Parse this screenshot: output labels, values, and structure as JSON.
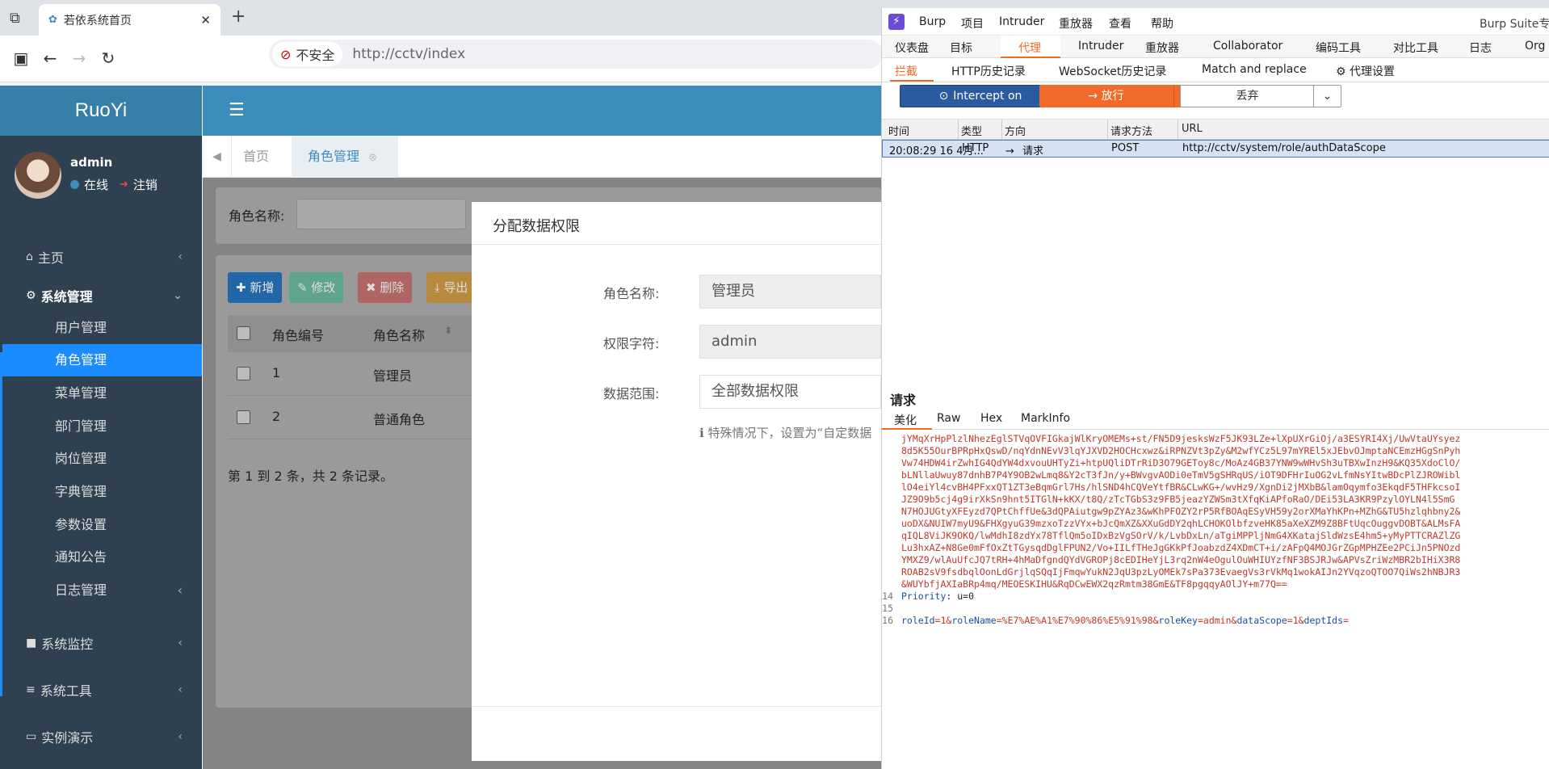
{
  "browser": {
    "tab_title": "若依系统首页",
    "tab_close": "✕",
    "new_tab": "+",
    "insecure_label": "不安全",
    "url": "http://cctv/index"
  },
  "app": {
    "logo": "RuoYi",
    "user": {
      "name": "admin",
      "status": "在线",
      "logout": "注销"
    },
    "menu": [
      {
        "label": "主页"
      },
      {
        "label": "系统管理"
      },
      {
        "label": "系统监控"
      },
      {
        "label": "系统工具"
      },
      {
        "label": "实例演示"
      }
    ],
    "submenu": [
      "用户管理",
      "角色管理",
      "菜单管理",
      "部门管理",
      "岗位管理",
      "字典管理",
      "参数设置",
      "通知公告",
      "日志管理"
    ],
    "tabs": {
      "home": "首页",
      "role": "角色管理"
    },
    "search": {
      "label": "角色名称:"
    },
    "toolbar": {
      "add": "新增",
      "edit": "修改",
      "delete": "删除",
      "export": "导出"
    },
    "table": {
      "headers": [
        "角色编号",
        "角色名称"
      ],
      "rows": [
        {
          "id": "1",
          "name": "管理员"
        },
        {
          "id": "2",
          "name": "普通角色"
        }
      ],
      "pager": "第 1 到 2 条，共 2 条记录。"
    }
  },
  "modal": {
    "title": "分配数据权限",
    "fields": [
      {
        "label": "角色名称:",
        "value": "管理员"
      },
      {
        "label": "权限字符:",
        "value": "admin"
      },
      {
        "label": "数据范围:",
        "value": "全部数据权限"
      }
    ],
    "hint": "特殊情况下，设置为“自定数据"
  },
  "burp": {
    "menu": [
      "Burp",
      "项目",
      "Intruder",
      "重放器",
      "查看",
      "帮助"
    ],
    "title": "Burp Suite专",
    "tabs": [
      "仪表盘",
      "目标",
      "代理",
      "Intruder",
      "重放器",
      "Collaborator",
      "编码工具",
      "对比工具",
      "日志",
      "Org"
    ],
    "subtabs": [
      "拦截",
      "HTTP历史记录",
      "WebSocket历史记录",
      "Match and replace",
      "代理设置"
    ],
    "buttons": {
      "intercept": "Intercept on",
      "forward": "放行",
      "drop": "丢弃"
    },
    "history_headers": [
      "时间",
      "类型",
      "方向",
      "请求方法",
      "URL"
    ],
    "history_row": {
      "time": "20:08:29 16 4月...",
      "type": "HTTP",
      "direction": "请求",
      "method": "POST",
      "url": "http://cctv/system/role/authDataScope"
    },
    "request_title": "请求",
    "request_tabs": [
      "美化",
      "Raw",
      "Hex",
      "MarkInfo"
    ],
    "code_lines": [
      "jYMqXrHpPlzlNhezEglSTVqOVFIGkajWlKryOMEMs+st/FN5D9jesksWzF5JK93LZe+lXpUXrGiOj/a3ESYRI4Xj/UwVtaUYsyez",
      "8d5K55OurBPRpHxQswD/nqYdnNEvV3lqYJXVD2HOCHcxwz&iRPNZVt3pZy&M2wfYCz5L97mYREl5xJEbvOJmptaNCEmzHGgSnPyh",
      "Vw74HDW4irZwhIG4QdYW4dxvouUHTyZi+htpUQliDTrRiD3O79GEToy8c/MoAz4GB37YNW9wWHvSh3uTBXwInzH9&KQ35XdoClO/",
      "bLNllaUwuy87dnhB7P4Y9OB2wLmq8&Y2cT3fJn/y+BWvgvAODi0eTmV5gSHRqUS/iOT9DFHrIuOG2vLfmNsYItwBDcPlZJROWibl",
      "lO4eiYl4cvBH4PFxxQT1ZT3eBqmGrl7Hs/hlSND4hCQVeYtfBR&CLwKG+/wvHz9/XgnDi2jMXbB&lamOqymfo3EkqdF5THFkcsoI",
      "JZ9O9b5cj4g9irXkSn9hnt5ITGlN+kKX/t8Q/zTcTGbS3z9FB5jeazYZWSm3tXfqKiAPfoRaO/DEi53LA3KR9PzylOYLN4l5SmG",
      "N7HOJUGtyXFEyzd7QPtChffUe&3dQPAiutgw9pZYAz3&wKhPFOZY2rP5RfBOAqESyVH59y2orXMaYhKPn+MZhG&TU5hzlqhbny2&",
      "uoDX&NUIW7myU9&FHXgyuG39mzxoTzzVYx+bJcQmXZ&XXuGdDY2qhLCHOKOlbfzveHK85aXeXZM9Z8BFtUqcOuggvDOBT&ALMsFA",
      "qIQL8ViJK9OKQ/lwMdhI8zdYx78TflQm5oIDxBzVgSOrV/k/LvbDxLn/aTgiMPPljNmG4XKatajSldWzsE4hm5+yMyPTTCRAZlZG",
      "Lu3hxAZ+N8Ge0mFfOxZtTGysqdDglFPUN2/Vo+IILfTHeJgGKkPfJoabzdZ4XDmCT+i/zAFpQ4MOJGrZGpMPHZEe2PCiJn5PNOzd",
      "YMXZ9/wlAuUfcJQ7tRH+4hMaDfgndQYdVGROPj8cEDIHeYjL3rq2nW4eOgulOuWHIUYzfNF3BSJRJw&APVsZriWzMBR2bIHiX3R8",
      "ROAB2sV9fsdbqlOonLdGrjlqSQqIjFmqwYukN2JqU3pzLyOMEk7sPa373EvaegVs3rVkMq1wokAIJn2YVqzoQTOO7QiWs2hNBJR3",
      "&WUYbfjAXIaBRp4mq/MEOESKIHU&RqDCwEWX2qzRmtm38GmE&TF8pgqqyAOlJY+m77Q=="
    ],
    "priority_line": {
      "num": "14",
      "key": "Priority",
      "val": ": u=0"
    },
    "blank_line": {
      "num": "15"
    },
    "body_line": {
      "num": "16",
      "parts": [
        "roleId",
        "=1&",
        "roleName",
        "=%E7%AE%A1%E7%90%86%E5%91%98&",
        "roleKey",
        "=admin&",
        "dataScope",
        "=1&",
        "deptIds",
        "="
      ]
    }
  }
}
